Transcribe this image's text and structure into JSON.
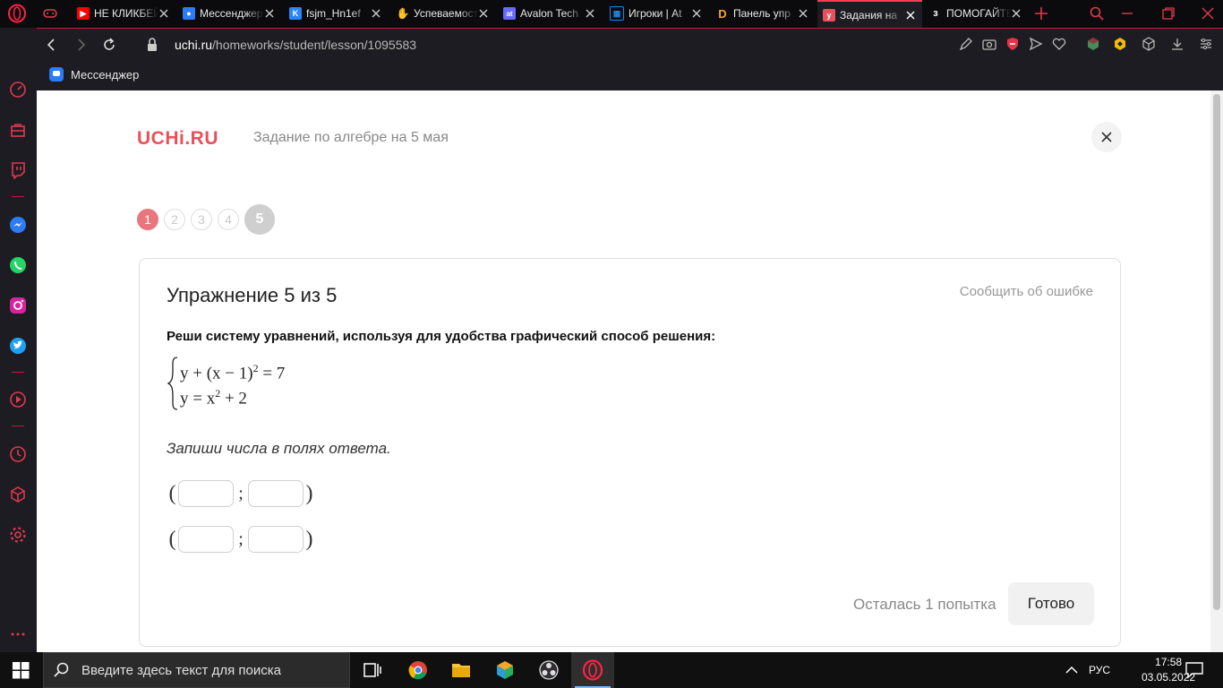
{
  "browser": {
    "tabs": [
      {
        "title": "",
        "favicon": "gamepad-icon",
        "color": "#e03a4d"
      },
      {
        "title": "НЕ КЛИКБЕЙТ",
        "favicon": "youtube-icon",
        "color": "#ff0000"
      },
      {
        "title": "Мессенджер",
        "favicon": "messenger-icon",
        "color": "#2d7cf6"
      },
      {
        "title": "fsjm_Hn1ef",
        "favicon": "vk-icon",
        "color": "#2787f5"
      },
      {
        "title": "Успеваемость",
        "favicon": "hand-icon",
        "color": "#f0b25e"
      },
      {
        "title": "Avalon Tech",
        "favicon": "avalon-icon",
        "color": "#6a6aff"
      },
      {
        "title": "Игроки | At",
        "favicon": "grid-icon",
        "color": "#1e88e5"
      },
      {
        "title": "Панель упр",
        "favicon": "d-icon",
        "color": "#f5a623"
      },
      {
        "title": "Задания на",
        "favicon": "uchi-icon",
        "color": "#e8515b",
        "active": true
      },
      {
        "title": "ПОМОГАЙТЕ",
        "favicon": "z-icon",
        "color": "#ffffff"
      }
    ],
    "url_host": "uchi.ru",
    "url_path": "/homeworks/student/lesson/1095583",
    "bookmarks": [
      {
        "label": "Мессенджер",
        "icon": "messenger-icon"
      }
    ],
    "accent": "#c01b36"
  },
  "page": {
    "logo": "UCHi.RU",
    "subtitle": "Задание по алгебре на 5 мая",
    "steps": [
      "1",
      "2",
      "3",
      "4",
      "5"
    ],
    "current_step": 5,
    "card": {
      "title": "Упражнение 5 из 5",
      "report": "Сообщить об ошибке",
      "instruction": "Реши систему уравнений, используя для удобства графический способ решения:",
      "eq1_pre": "y + (x − 1)",
      "eq1_exp": "2",
      "eq1_post": " = 7",
      "eq2_pre": "y = x",
      "eq2_exp": "2",
      "eq2_post": " + 2",
      "hint": "Запиши числа в полях ответа.",
      "answer_rows": [
        {
          "open": "(",
          "sep": ";",
          "close": ")",
          "x": "",
          "y": ""
        },
        {
          "open": "(",
          "sep": ";",
          "close": ")",
          "x": "",
          "y": ""
        }
      ],
      "attempts": "Осталась 1 попытка",
      "done": "Готово"
    },
    "colors": {
      "brand": "#e8515b",
      "step_done": "#e8767d"
    }
  },
  "taskbar": {
    "search_placeholder": "Введите здесь текст для поиска",
    "lang": "РУС",
    "time": "17:58",
    "date": "03.05.2022"
  }
}
